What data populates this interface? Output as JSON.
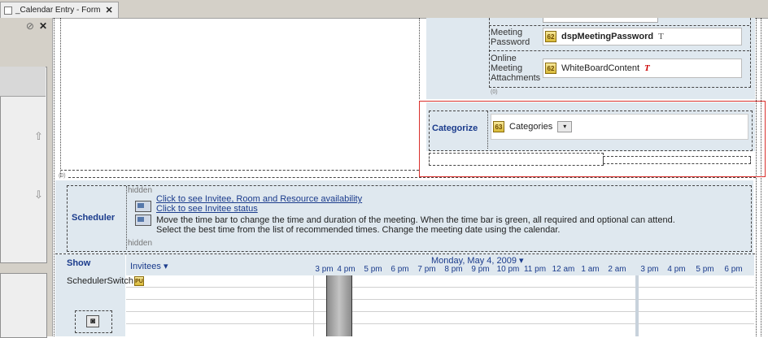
{
  "tab": {
    "title": "_Calendar Entry - Form",
    "close": "✕"
  },
  "left_panel": {
    "pin": "⊘",
    "close": "✕"
  },
  "form": {
    "password_label": "Password",
    "meeting_password_label": "Meeting Password",
    "meeting_password_field": "dspMeetingPassword",
    "meeting_password_type": "T",
    "online_attachments_label": "Online Meeting Attachments",
    "whiteboard_field": "WhiteBoardContent",
    "whiteboard_type": "T",
    "field_icon_62": "62",
    "field_icon_63": "63",
    "categorize_label": "Categorize",
    "categories_field": "Categories",
    "hidden_tag": "hidden",
    "small_tag": "(0)"
  },
  "scheduler": {
    "label": "Scheduler",
    "hidden_top": "hidden",
    "hidden_bottom": "hidden",
    "link1": "Click to see Invitee, Room and Resource availability",
    "link2": "Click to see Invitee status",
    "note1": "Move the time bar to change the time and duration of the meeting.  When the time bar is green, all required and optional can attend.",
    "note2": "Select the best time from the list of recommended times.  Change the meeting date using the calendar.",
    "show_label": "Show",
    "invitees_label": "Invitees ▾",
    "date": "Monday, May 4, 2009 ▾",
    "scheduler_switch": "SchedulerSwitch",
    "hours": [
      "3 pm",
      "4 pm",
      "5 pm",
      "6 pm",
      "7 pm",
      "8 pm",
      "9 pm",
      "10 pm",
      "11 pm",
      "12 am",
      "1 am",
      "2 am",
      "3 pm",
      "4 pm",
      "5 pm",
      "6 pm"
    ]
  },
  "colors": {
    "selection_red": "#d9302c",
    "section_blue": "#dfe8ef",
    "link_blue": "#1a3b8c"
  }
}
